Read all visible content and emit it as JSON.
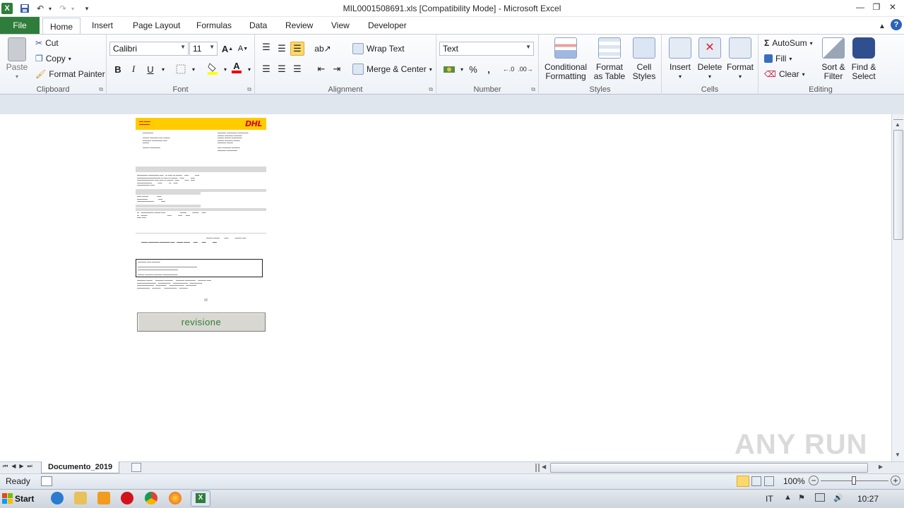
{
  "window": {
    "title": "MIL0001508691.xls  [Compatibility Mode]  -  Microsoft Excel"
  },
  "ribbon_tabs": [
    "File",
    "Home",
    "Insert",
    "Page Layout",
    "Formulas",
    "Data",
    "Review",
    "View",
    "Developer"
  ],
  "clipboard": {
    "paste": "Paste",
    "cut": "Cut",
    "copy": "Copy",
    "format_painter": "Format Painter",
    "label": "Clipboard"
  },
  "font": {
    "name": "Calibri",
    "size": "11",
    "label": "Font"
  },
  "alignment": {
    "wrap_text": "Wrap Text",
    "merge_center": "Merge & Center",
    "label": "Alignment"
  },
  "number": {
    "format": "Text",
    "label": "Number"
  },
  "styles": {
    "conditional_1": "Conditional",
    "conditional_2": "Formatting",
    "format_table_1": "Format",
    "format_table_2": "as Table",
    "cell_styles_1": "Cell",
    "cell_styles_2": "Styles",
    "label": "Styles"
  },
  "cells": {
    "insert": "Insert",
    "delete": "Delete",
    "format": "Format",
    "label": "Cells"
  },
  "editing": {
    "autosum": "AutoSum",
    "fill": "Fill",
    "clear": "Clear",
    "sort_1": "Sort &",
    "sort_2": "Filter",
    "find_1": "Find &",
    "find_2": "Select",
    "label": "Editing"
  },
  "document": {
    "revision_button": "revisione"
  },
  "sheet_tab": "Documento_2019",
  "status": {
    "ready": "Ready",
    "zoom": "100%"
  },
  "taskbar": {
    "start": "Start",
    "lang": "IT",
    "time": "10:27"
  },
  "watermark": "ANY RUN",
  "colors": {
    "file_tab": "#2f7d3a",
    "dhl_yellow": "#ffcc00",
    "dhl_red": "#d40511",
    "revision_text": "#2e7d32"
  }
}
